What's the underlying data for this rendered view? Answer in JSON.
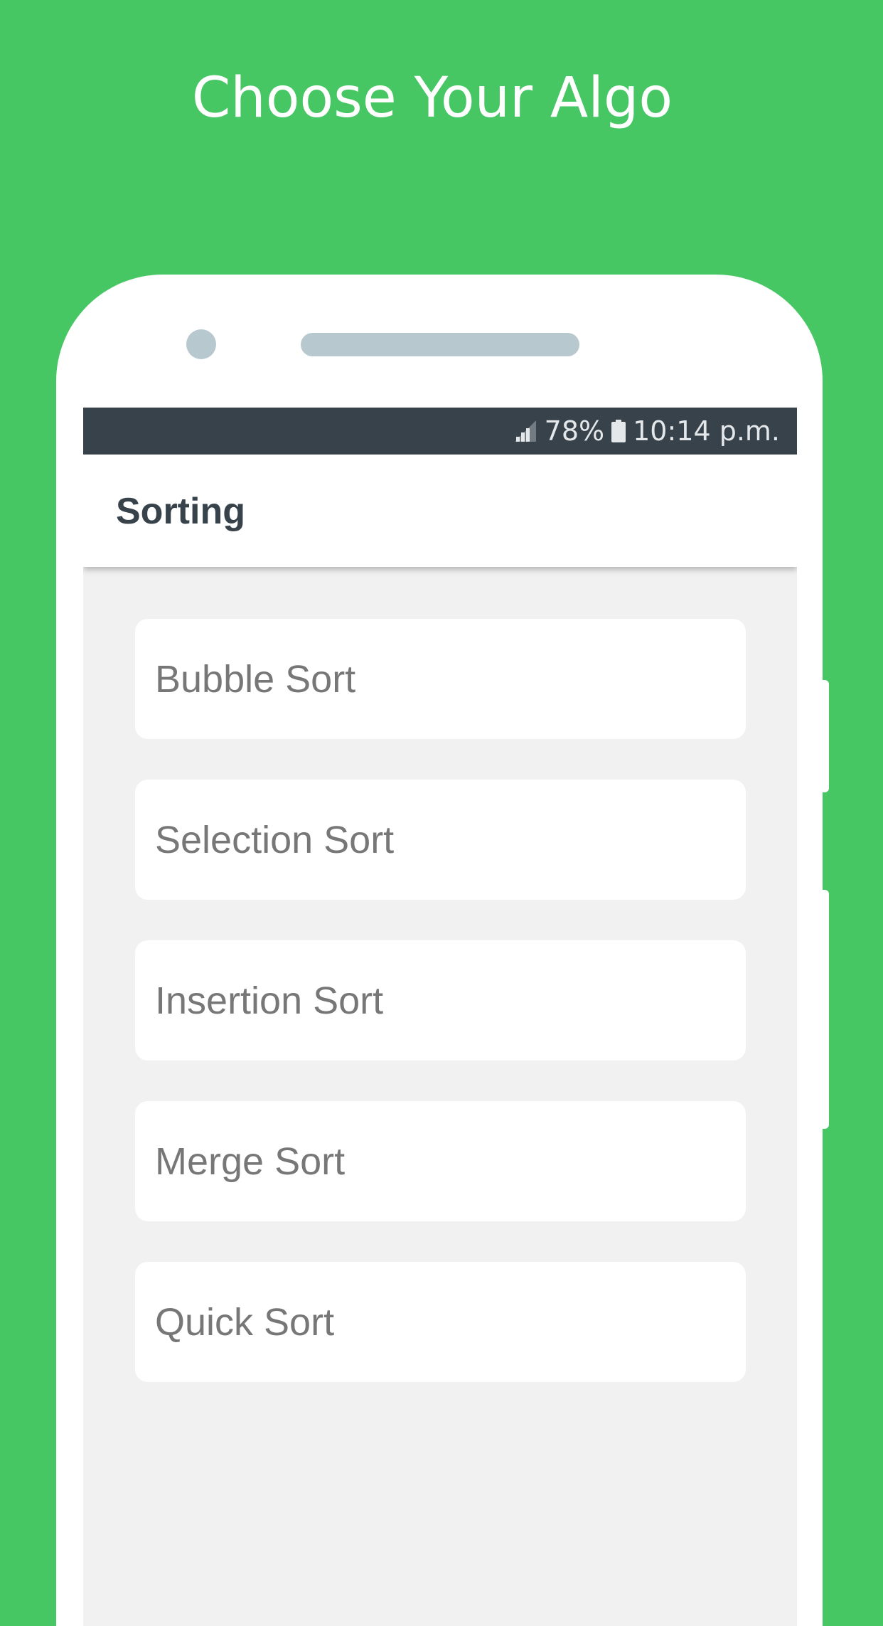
{
  "headline": "Choose Your Algo",
  "status_bar": {
    "signal_icon": "signal-icon",
    "battery_percent": "78%",
    "battery_icon": "battery-icon",
    "time": "10:14 p.m."
  },
  "app_bar": {
    "title": "Sorting"
  },
  "algorithms": [
    {
      "label": "Bubble Sort"
    },
    {
      "label": "Selection Sort"
    },
    {
      "label": "Insertion Sort"
    },
    {
      "label": "Merge Sort"
    },
    {
      "label": "Quick Sort"
    }
  ],
  "colors": {
    "background": "#47c764",
    "status_bar": "#37424b",
    "screen_bg": "#f1f1f1",
    "card_text": "#777777",
    "title_text": "#37424b"
  }
}
